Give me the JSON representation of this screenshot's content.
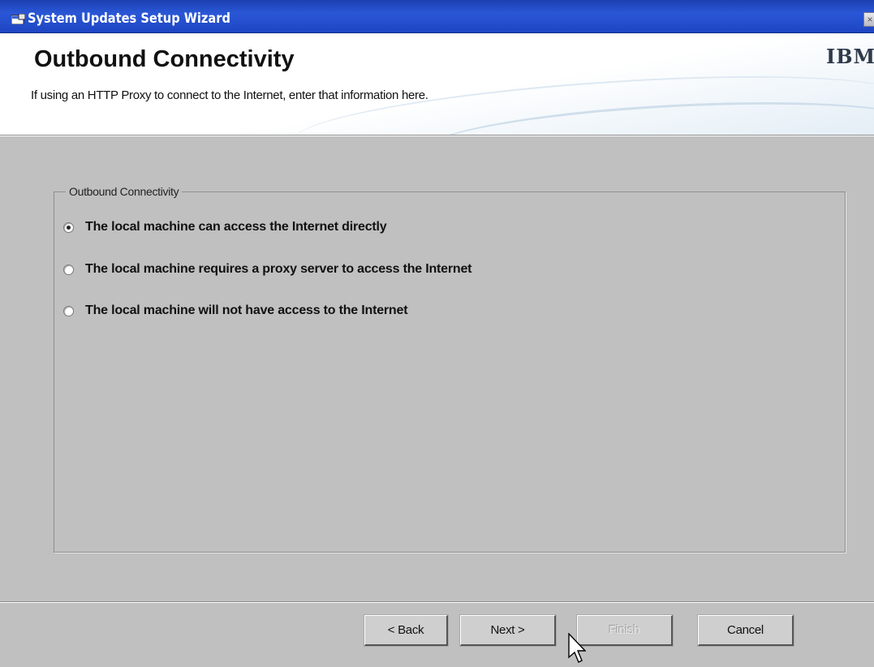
{
  "window": {
    "title": "System Updates Setup Wizard",
    "close_glyph": "×",
    "app_icon": "wizard-app-icon"
  },
  "header": {
    "title": "Outbound Connectivity",
    "subtitle": "If using an HTTP Proxy to connect to the Internet, enter that information here.",
    "logo": "IBM"
  },
  "group": {
    "legend": "Outbound Connectivity",
    "options": [
      {
        "label": "The local machine can access the Internet directly",
        "selected": true
      },
      {
        "label": "The local machine requires a proxy server to access the Internet",
        "selected": false
      },
      {
        "label": "The local machine will not have access to the Internet",
        "selected": false
      }
    ]
  },
  "buttons": {
    "back": "< Back",
    "next": "Next >",
    "finish": "Finish",
    "cancel": "Cancel",
    "finish_enabled": false
  },
  "colors": {
    "titlebar": "#2a57d6",
    "dialog_bg": "#c0c0c0",
    "header_bg": "#ffffff"
  }
}
